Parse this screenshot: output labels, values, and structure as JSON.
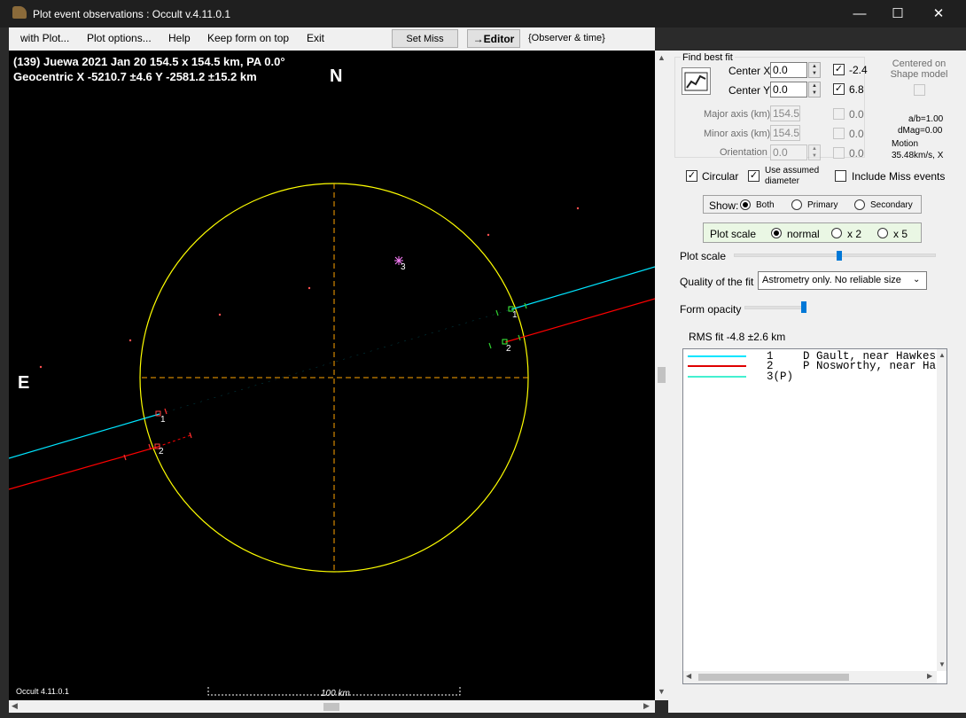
{
  "window": {
    "title": "Plot event observations : Occult v.4.11.0.1",
    "min": "—",
    "max": "☐",
    "close": "✕"
  },
  "menu": {
    "with_plot": "with Plot...",
    "plot_options": "Plot options...",
    "help": "Help",
    "keep_on_top": "Keep form on top",
    "exit": "Exit",
    "set_miss_times": "Set Miss Times",
    "editor": "→Editor",
    "observer_time": "{Observer & time}"
  },
  "plot": {
    "header_line1": "(139) Juewa  2021 Jan 20   154.5 x 154.5 km, PA 0.0°",
    "header_line2": "Geocentric  X  -5210.7 ±4.6  Y -2581.2 ±15.2 km",
    "north": "N",
    "east": "E",
    "footer_version": "Occult 4.11.0.1",
    "scale_label": "100 km",
    "chord_labels": [
      "1",
      "2",
      "1",
      "2",
      "3"
    ]
  },
  "panel": {
    "find_best_fit": "Find best fit",
    "center_x_label": "Center X",
    "center_x_value": "0.0",
    "center_y_label": "Center Y",
    "center_y_value": "0.0",
    "center_x_result": "-2.4",
    "center_y_result": "6.8",
    "centered_on_shape": "Centered on Shape model",
    "major_axis_label": "Major axis (km)",
    "major_axis_value": "154.5",
    "minor_axis_label": "Minor axis (km)",
    "minor_axis_value": "154.5",
    "orientation_label": "Orientation",
    "orientation_value": "0.0",
    "major_result": "0.0",
    "minor_result": "0.0",
    "orient_result": "0.0",
    "ab_ratio": "a/b=1.00",
    "dmag": "dMag=0.00",
    "motion_label": "Motion",
    "motion_value": "35.48km/s, X",
    "circular": "Circular",
    "use_assumed": "Use assumed diameter",
    "include_miss": "Include Miss events",
    "show_label": "Show:",
    "show_both": "Both",
    "show_primary": "Primary",
    "show_secondary": "Secondary",
    "plot_scale_label": "Plot scale",
    "scale_normal": "normal",
    "scale_x2": "x 2",
    "scale_x5": "x 5",
    "plot_scale_slider_label": "Plot scale",
    "plot_scale_level": 0.52,
    "quality_label": "Quality of the fit",
    "quality_value": "Astrometry only. No reliable size",
    "opacity_label": "Form opacity",
    "opacity_level": 0.95,
    "rms_fit": "RMS fit -4.8 ±2.6 km"
  },
  "legend": [
    {
      "num": "1",
      "flag": "D",
      "name": "Gault, near Hawkes",
      "color": "#00e5ff"
    },
    {
      "num": "2",
      "flag": "P",
      "name": "Nosworthy, near Ha",
      "color": "#e00000"
    },
    {
      "num": "3(P)",
      "flag": "",
      "name": "",
      "color": "#44f0d0"
    }
  ],
  "colors": {
    "limb": "#ffff00",
    "crosshair": "#ffa500",
    "chord1": "#00e5ff",
    "chord2": "#ff0000",
    "accent": "#0078d7"
  }
}
